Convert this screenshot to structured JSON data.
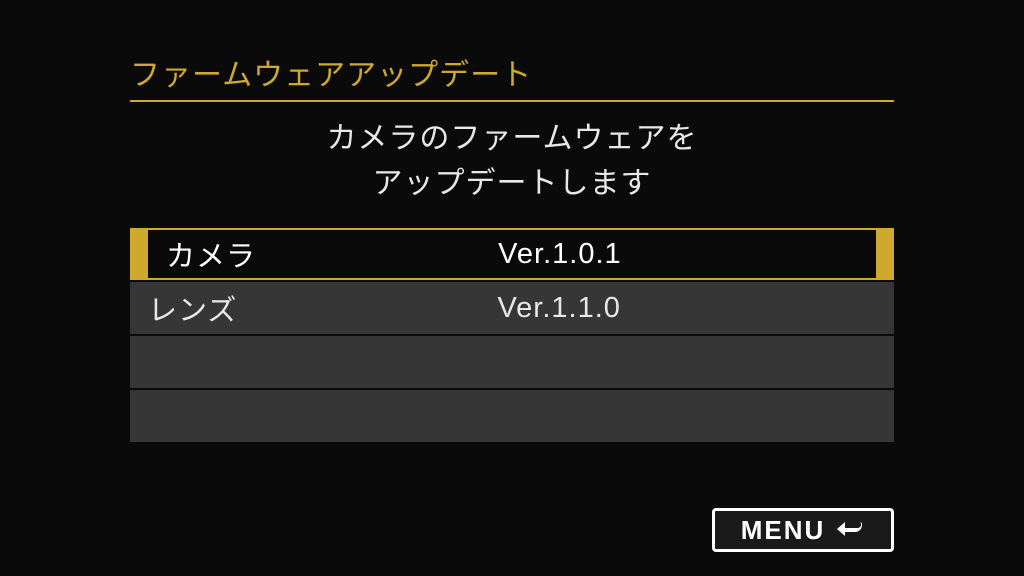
{
  "title": "ファームウェアアップデート",
  "subtitle_line1": "カメラのファームウェアを",
  "subtitle_line2": "アップデートします",
  "rows": [
    {
      "label": "カメラ",
      "value": "Ver.1.0.1",
      "selected": true
    },
    {
      "label": "レンズ",
      "value": "Ver.1.1.0",
      "selected": false
    }
  ],
  "menu_label": "MENU"
}
